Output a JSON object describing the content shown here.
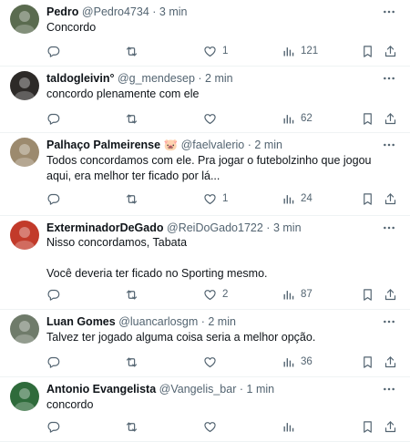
{
  "replies": [
    {
      "name": "Pedro",
      "handle": "@Pedro4734",
      "sep": "·",
      "time": "3 min",
      "text": "Concordo",
      "replies": "",
      "reposts": "",
      "likes": "1",
      "views": "121",
      "avatar_color": "#5a6b4f"
    },
    {
      "name": "taldogleivin°",
      "handle": "@g_mendesep",
      "sep": "·",
      "time": "2 min",
      "text": "concordo plenamente com ele",
      "replies": "",
      "reposts": "",
      "likes": "",
      "views": "62",
      "avatar_color": "#2d2a28"
    },
    {
      "name": "Palhaço Palmeirense 🐷",
      "handle": "@faelvalerio",
      "sep": "·",
      "time": "2 min",
      "text": "Todos concordamos com ele. Pra jogar o futebolzinho que jogou aqui, era melhor ter ficado por lá...",
      "replies": "",
      "reposts": "",
      "likes": "1",
      "views": "24",
      "avatar_color": "#9c8a6e"
    },
    {
      "name": "ExterminadorDeGado",
      "handle": "@ReiDoGado1722",
      "sep": "·",
      "time": "3 min",
      "text": "Nisso concordamos, Tabata\n\nVocê deveria ter ficado no Sporting mesmo.",
      "replies": "",
      "reposts": "",
      "likes": "2",
      "views": "87",
      "avatar_color": "#c23a2a"
    },
    {
      "name": "Luan Gomes",
      "handle": "@luancarlosgm",
      "sep": "·",
      "time": "2 min",
      "text": "Talvez ter jogado alguma coisa seria a melhor opção.",
      "replies": "",
      "reposts": "",
      "likes": "",
      "views": "36",
      "avatar_color": "#6f7b6a"
    },
    {
      "name": "Antonio Evangelista",
      "handle": "@Vangelis_bar",
      "sep": "·",
      "time": "1 min",
      "text": "concordo",
      "replies": "",
      "reposts": "",
      "likes": "",
      "views": "",
      "avatar_color": "#2f6b3b"
    }
  ],
  "icons": {
    "reply": "reply-icon",
    "repost": "repost-icon",
    "like": "like-icon",
    "views": "views-icon",
    "bookmark": "bookmark-icon",
    "share": "share-icon",
    "more": "more-icon"
  },
  "colors": {
    "text": "#0f1419",
    "secondary": "#536471",
    "divider": "#eff3f4"
  }
}
